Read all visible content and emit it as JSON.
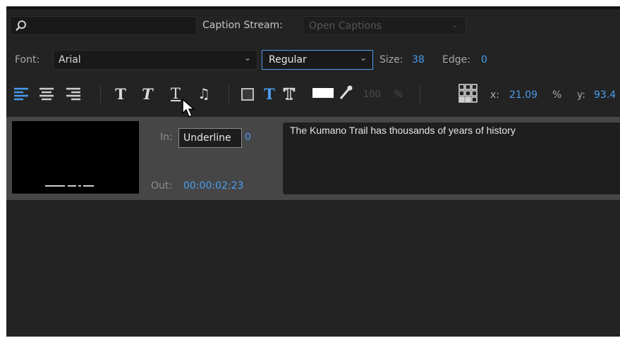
{
  "toolbar": {
    "caption_stream_label": "Caption Stream:",
    "caption_stream_value": "Open Captions",
    "font_label": "Font:",
    "font_value": "Arial",
    "style_value": "Regular",
    "size_label": "Size:",
    "size_value": "38",
    "edge_label": "Edge:",
    "edge_value": "0",
    "opacity_value": "100",
    "opacity_unit": "%",
    "x_label": "x:",
    "x_value": "21.09",
    "x_unit": "%",
    "y_label": "y:",
    "y_value": "93.4"
  },
  "tooltip": {
    "text": "Underline"
  },
  "caption": {
    "in_label": "In:",
    "in_value_tail": "0",
    "out_label": "Out:",
    "out_value": "00:00:02:23",
    "text": "The Kumano Trail has thousands of years of history"
  },
  "icons": [
    "search-icon",
    "align-left-icon",
    "align-center-icon",
    "align-right-icon",
    "bold-icon",
    "italic-icon",
    "underline-icon",
    "music-note-icon",
    "background-box-icon",
    "text-color-icon",
    "outline-text-icon",
    "color-swatch",
    "eyedropper-icon",
    "position-grid-icon",
    "mouse-cursor"
  ],
  "colors": {
    "accent": "#4a9df0",
    "panel": "#232323",
    "caption_row": "#464646"
  }
}
